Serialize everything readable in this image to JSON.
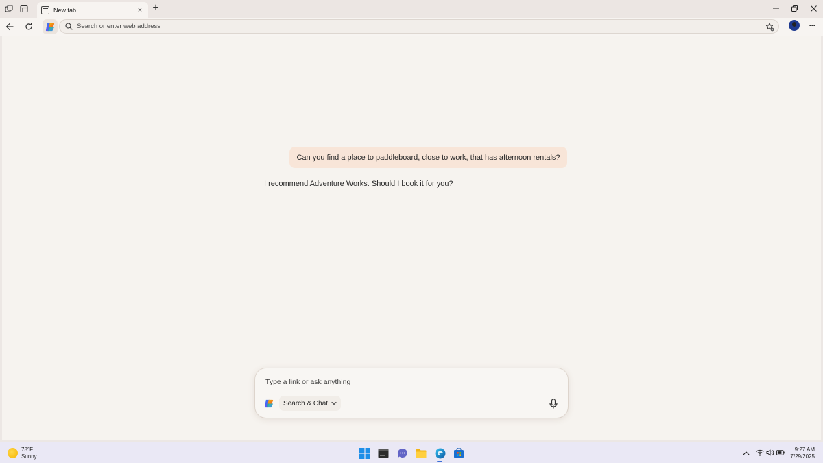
{
  "browser": {
    "tab": {
      "title": "New tab",
      "close_glyph": "×"
    },
    "new_tab_glyph": "+",
    "window_controls": {
      "minimize": "—",
      "restore": "❐",
      "close": "✕"
    },
    "address_bar": {
      "placeholder": "Search or enter web address",
      "value": ""
    },
    "more_glyph": "···"
  },
  "conversation": {
    "user_message": "Can you find a place to paddleboard, close to work, that has afternoon rentals?",
    "assistant_message": "I recommend Adventure Works. Should I book it for you?"
  },
  "composer": {
    "placeholder": "Type a link or ask anything",
    "mode_label": "Search & Chat"
  },
  "taskbar": {
    "weather": {
      "temp": "78°F",
      "condition": "Sunny"
    },
    "clock": {
      "time": "9:27 AM",
      "date": "7/29/2025"
    },
    "apps": [
      "windows-start-icon",
      "terminal-icon",
      "teams-chat-icon",
      "file-explorer-icon",
      "edge-icon",
      "store-icon"
    ]
  },
  "colors": {
    "user_bubble": "#f8e5d8",
    "content_bg": "#f6f3ef",
    "taskbar_bg": "#eae8f5"
  }
}
